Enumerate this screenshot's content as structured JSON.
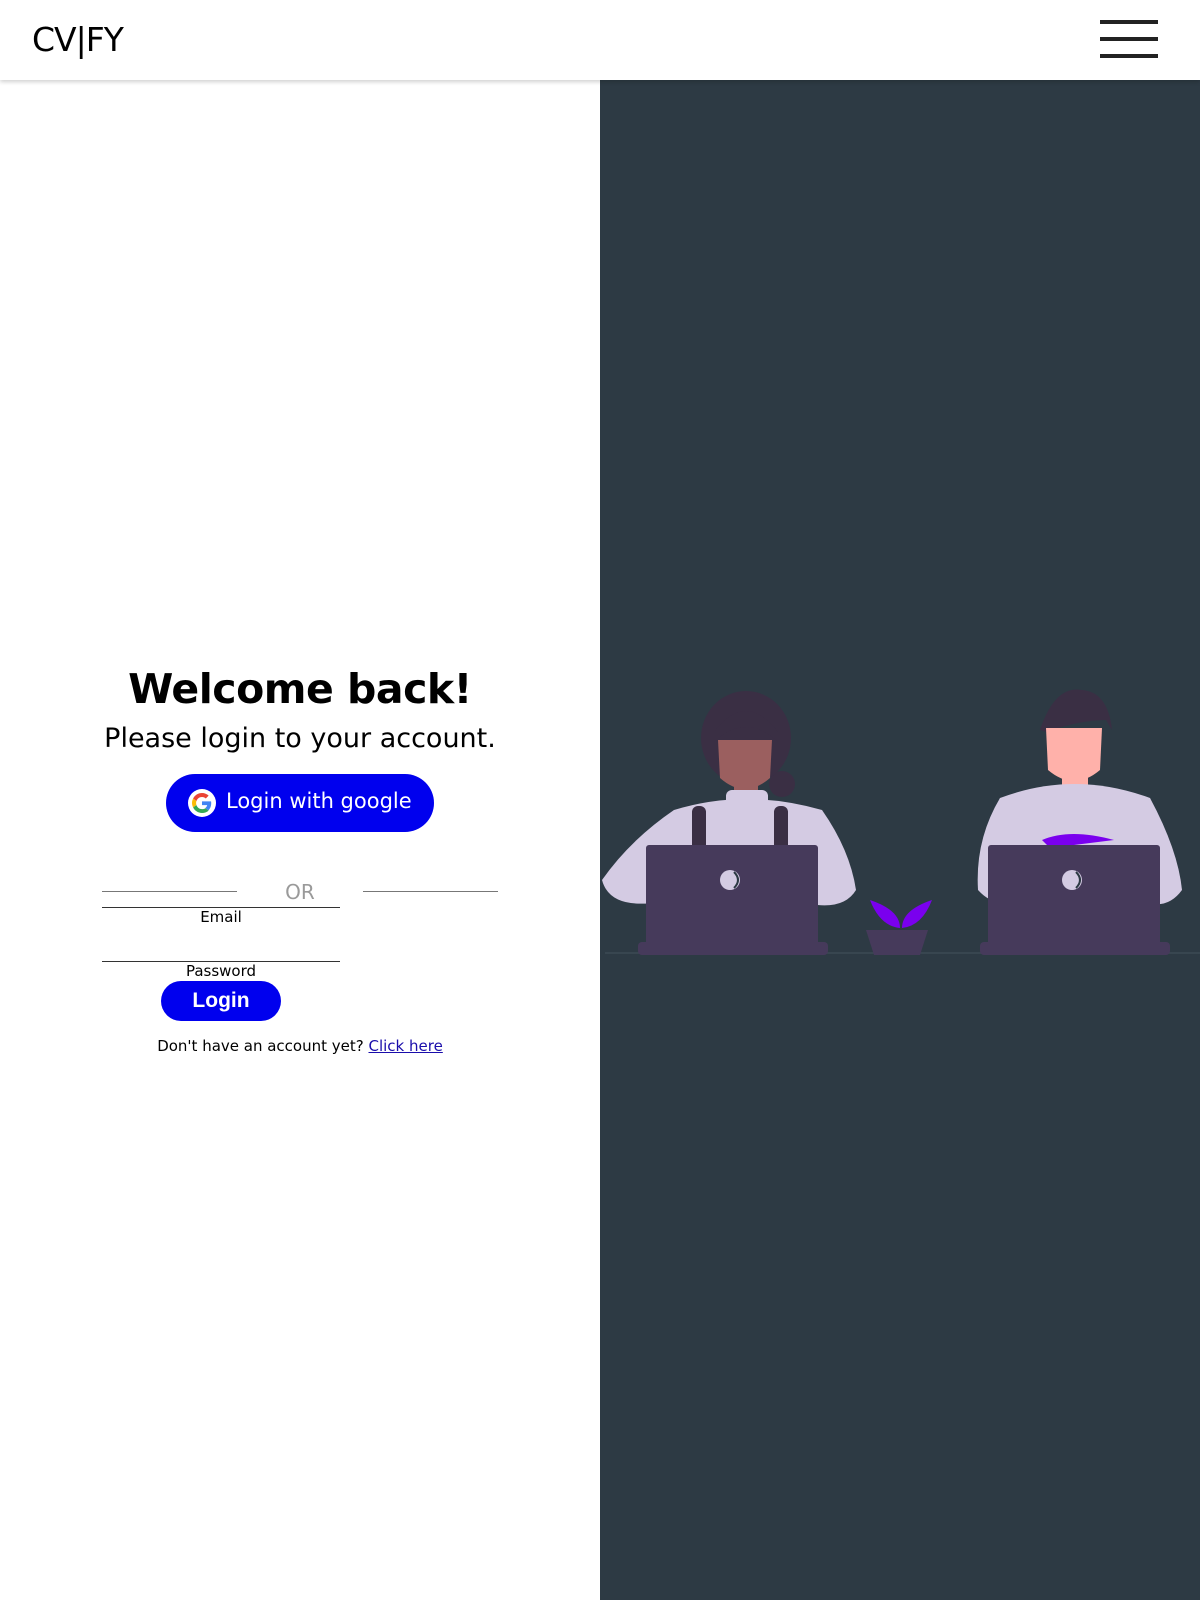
{
  "header": {
    "brand": "CV|FY",
    "menu_icon": "hamburger-menu-icon"
  },
  "login": {
    "title": "Welcome back!",
    "subtitle": "Please login to your account.",
    "google_button_label": "Login with google",
    "google_icon": "google-logo-icon",
    "divider_text": "OR",
    "email_label": "Email",
    "email_value": "",
    "password_label": "Password",
    "password_value": "",
    "submit_label": "Login",
    "signup_prompt": "Don't have an account yet?",
    "signup_link": "Click here"
  },
  "colors": {
    "primary": "#0000ee",
    "illustration_background": "#2d3a44",
    "link": "#1a0dab"
  }
}
